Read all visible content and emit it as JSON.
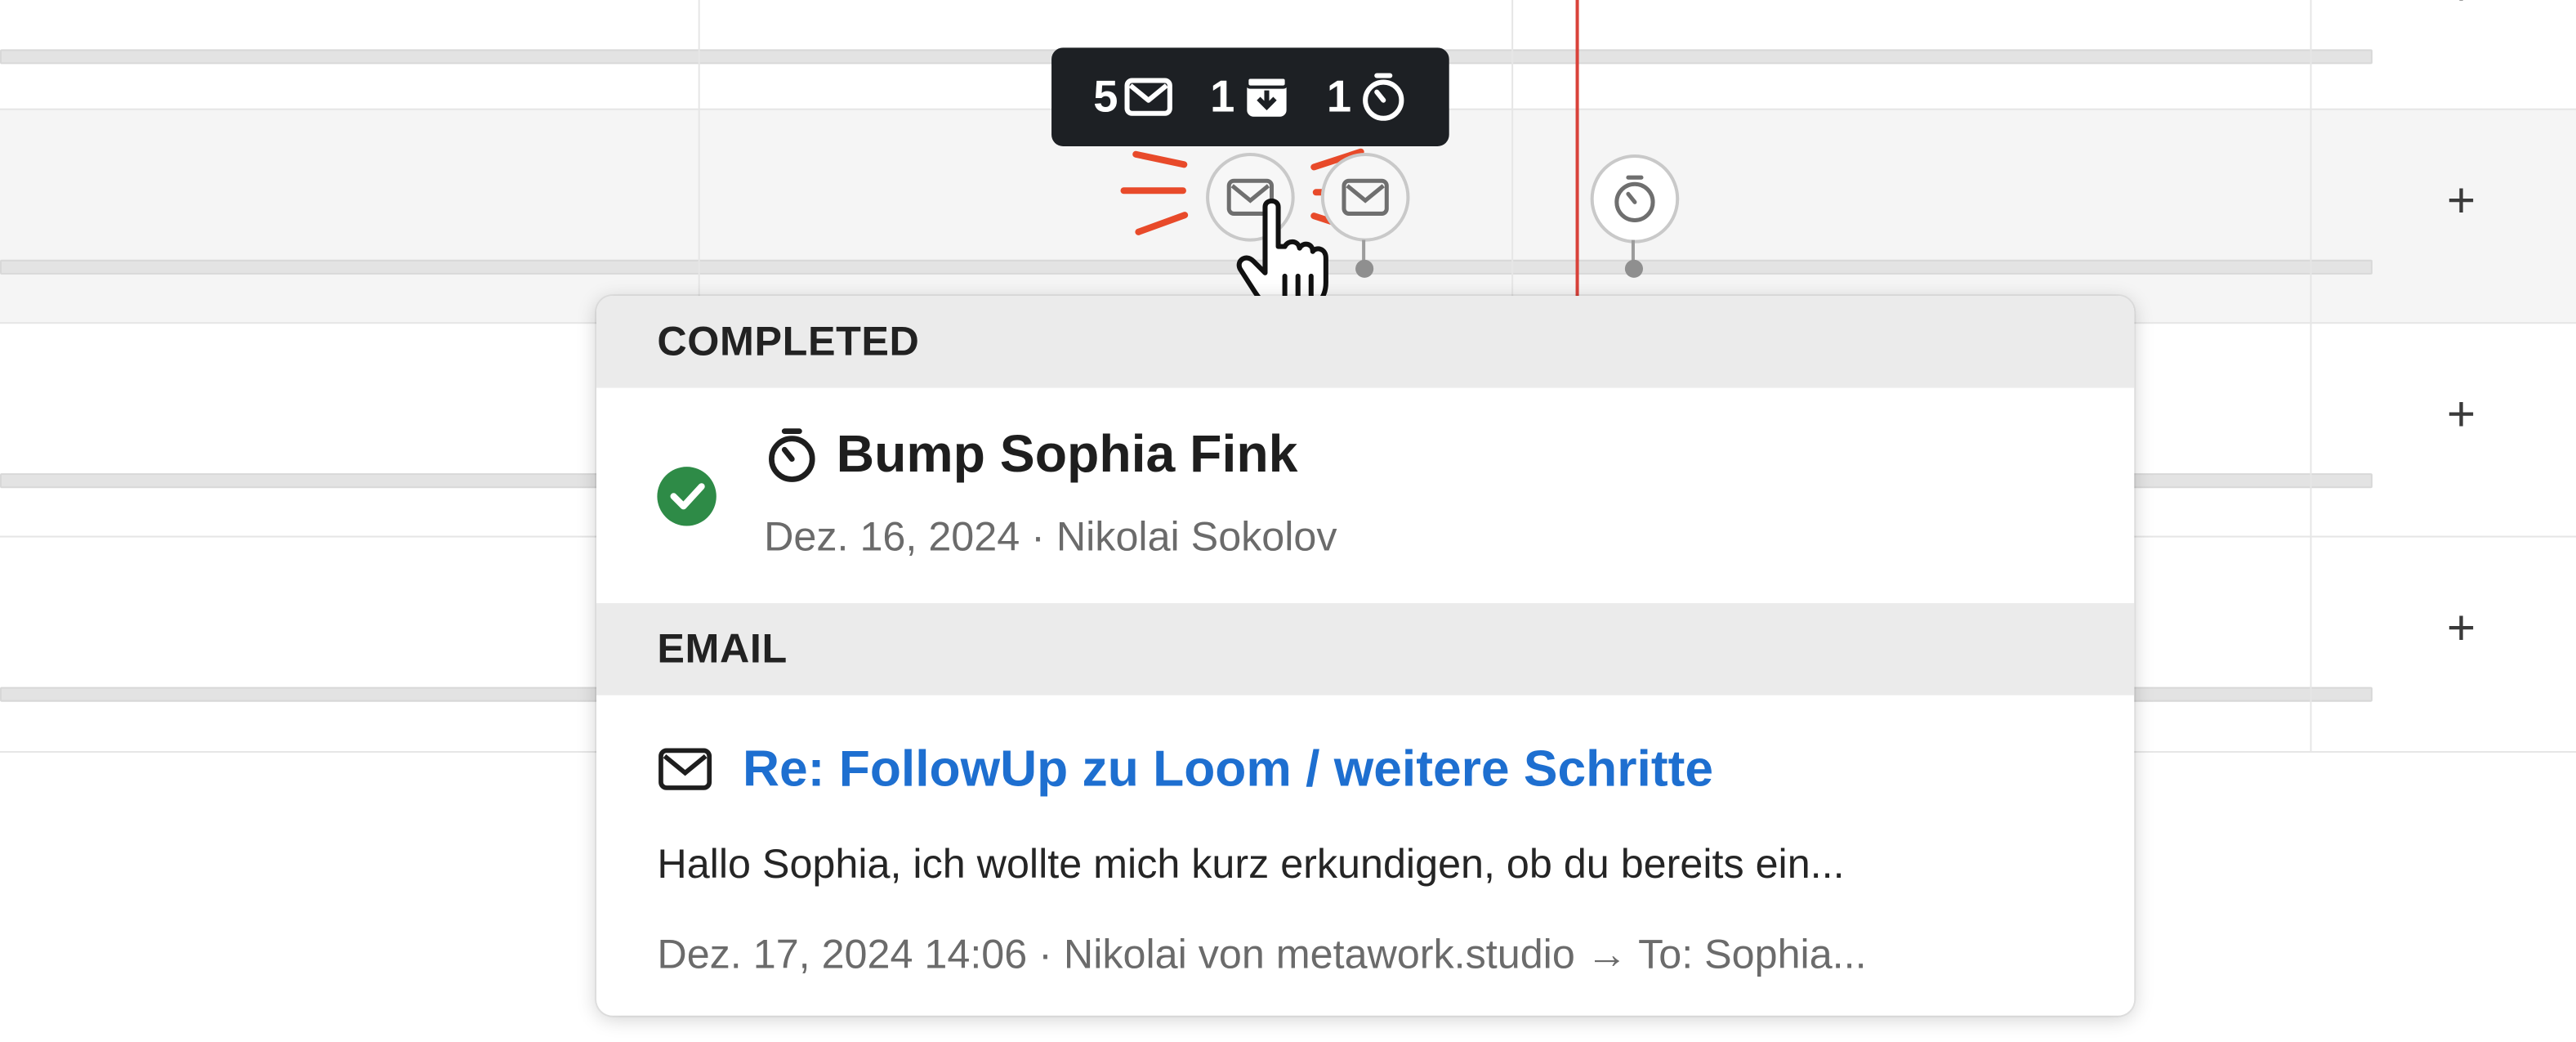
{
  "timeline": {
    "rows": [
      "row-1",
      "row-2",
      "row-3",
      "row-4"
    ],
    "add_label": "+"
  },
  "tooltip": {
    "email_count": "5",
    "download_count": "1",
    "timer_count": "1"
  },
  "popover": {
    "completed_header": "COMPLETED",
    "task_title": "Bump Sophia Fink",
    "task_meta": "Dez. 16, 2024 · Nikolai Sokolov",
    "email_header": "EMAIL",
    "email_subject": "Re: FollowUp zu Loom / weitere Schritte",
    "email_preview": "Hallo Sophia, ich wollte mich kurz erkundigen, ob du bereits ein...",
    "email_meta": "Dez. 17, 2024 14:06 · Nikolai von metawork.studio → To: Sophia..."
  },
  "icons": [
    "envelope-icon",
    "download-box-icon",
    "stopwatch-icon",
    "check-icon",
    "hand-cursor-icon",
    "plus-icon"
  ],
  "colors": {
    "accent_link": "#1e6fd0",
    "today_line": "#d9423a",
    "success": "#2e8b47",
    "tooltip_bg": "#1d2024"
  }
}
